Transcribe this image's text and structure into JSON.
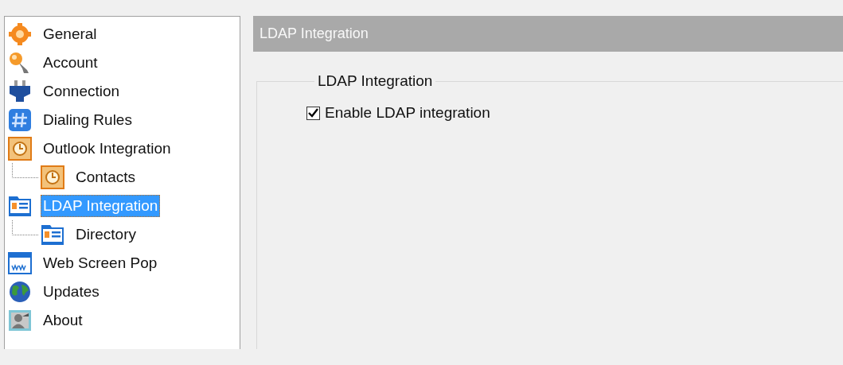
{
  "sidebar": {
    "items": [
      {
        "label": "General",
        "kind": "gear",
        "selected": false
      },
      {
        "label": "Account",
        "kind": "key",
        "selected": false
      },
      {
        "label": "Connection",
        "kind": "plug",
        "selected": false
      },
      {
        "label": "Dialing Rules",
        "kind": "hash",
        "selected": false
      },
      {
        "label": "Outlook Integration",
        "kind": "clock",
        "selected": false,
        "children": [
          {
            "label": "Contacts",
            "kind": "clock",
            "selected": false
          }
        ]
      },
      {
        "label": "LDAP Integration",
        "kind": "card",
        "selected": true,
        "children": [
          {
            "label": "Directory",
            "kind": "card",
            "selected": false
          }
        ]
      },
      {
        "label": "Web Screen Pop",
        "kind": "web",
        "selected": false
      },
      {
        "label": "Updates",
        "kind": "globe",
        "selected": false
      },
      {
        "label": "About",
        "kind": "person",
        "selected": false
      }
    ]
  },
  "panel": {
    "title": "LDAP Integration",
    "group": {
      "title": "LDAP Integration",
      "options": [
        {
          "label": "Enable LDAP integration",
          "checked": true
        }
      ]
    }
  }
}
